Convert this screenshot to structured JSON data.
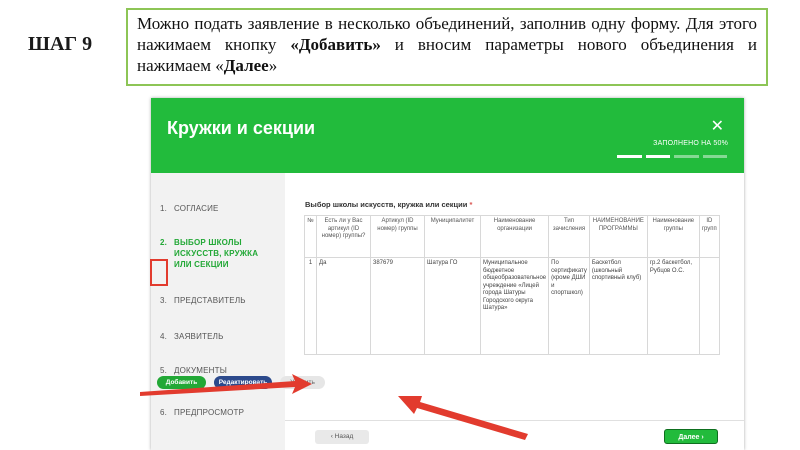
{
  "step_label": "ШАГ 9",
  "instruction": {
    "part1": "Можно подать заявление в несколько объединений, заполнив одну форму. Для этого нажимаем кнопку ",
    "bold1": "«Добавить»",
    "part2": " и вносим параметры нового объединения и нажимаем «",
    "bold2": "Далее",
    "part3": "»"
  },
  "modal": {
    "title": "Кружки и секции",
    "close_icon": "close-icon",
    "progress_label": "ЗАПОЛНЕНО НА 50%",
    "progress_fraction": 0.5
  },
  "sidebar": {
    "items": [
      {
        "num": "1.",
        "label": "СОГЛАСИЕ",
        "active": false
      },
      {
        "num": "2.",
        "label": "ВЫБОР ШКОЛЫ ИСКУССТВ, КРУЖКА ИЛИ СЕКЦИИ",
        "active": true
      },
      {
        "num": "3.",
        "label": "ПРЕДСТАВИТЕЛЬ",
        "active": false
      },
      {
        "num": "4.",
        "label": "ЗАЯВИТЕЛЬ",
        "active": false
      },
      {
        "num": "5.",
        "label": "ДОКУМЕНТЫ",
        "active": false
      },
      {
        "num": "6.",
        "label": "ПРЕДПРОСМОТР",
        "active": false
      }
    ]
  },
  "section_title": "Выбор школы искусств, кружка или секции",
  "required_mark": "*",
  "table": {
    "headers": [
      "№",
      "Есть ли у Вас артикул (ID номер) группы?",
      "Артикул (ID номер) группы",
      "Муниципалитет",
      "Наименование организации",
      "Тип зачисления",
      "НАИМЕНОВАНИЕ ПРОГРАММЫ",
      "Наименование группы",
      "ID групп"
    ],
    "rows": [
      [
        "1",
        "Да",
        "387679",
        "Шатура ГО",
        "Муниципальное бюджетное общеобразовательное учреждение «Лицей города Шатуры Городского округа Шатура»",
        "По сертификату (кроме ДШИ и спортшкол)",
        "Баскетбол (школьный спортивный клуб)",
        "гр.2 баскетбол, Рубцов О.С.",
        ""
      ]
    ]
  },
  "buttons": {
    "add": "Добавить",
    "edit": "Редактировать",
    "delete": "Удалить",
    "back": "Назад",
    "next": "Далее"
  },
  "colors": {
    "brand_green": "#22bb3c",
    "edit_blue": "#2c4a8c",
    "annotation_red": "#e23b2e",
    "note_border": "#8dc556"
  }
}
